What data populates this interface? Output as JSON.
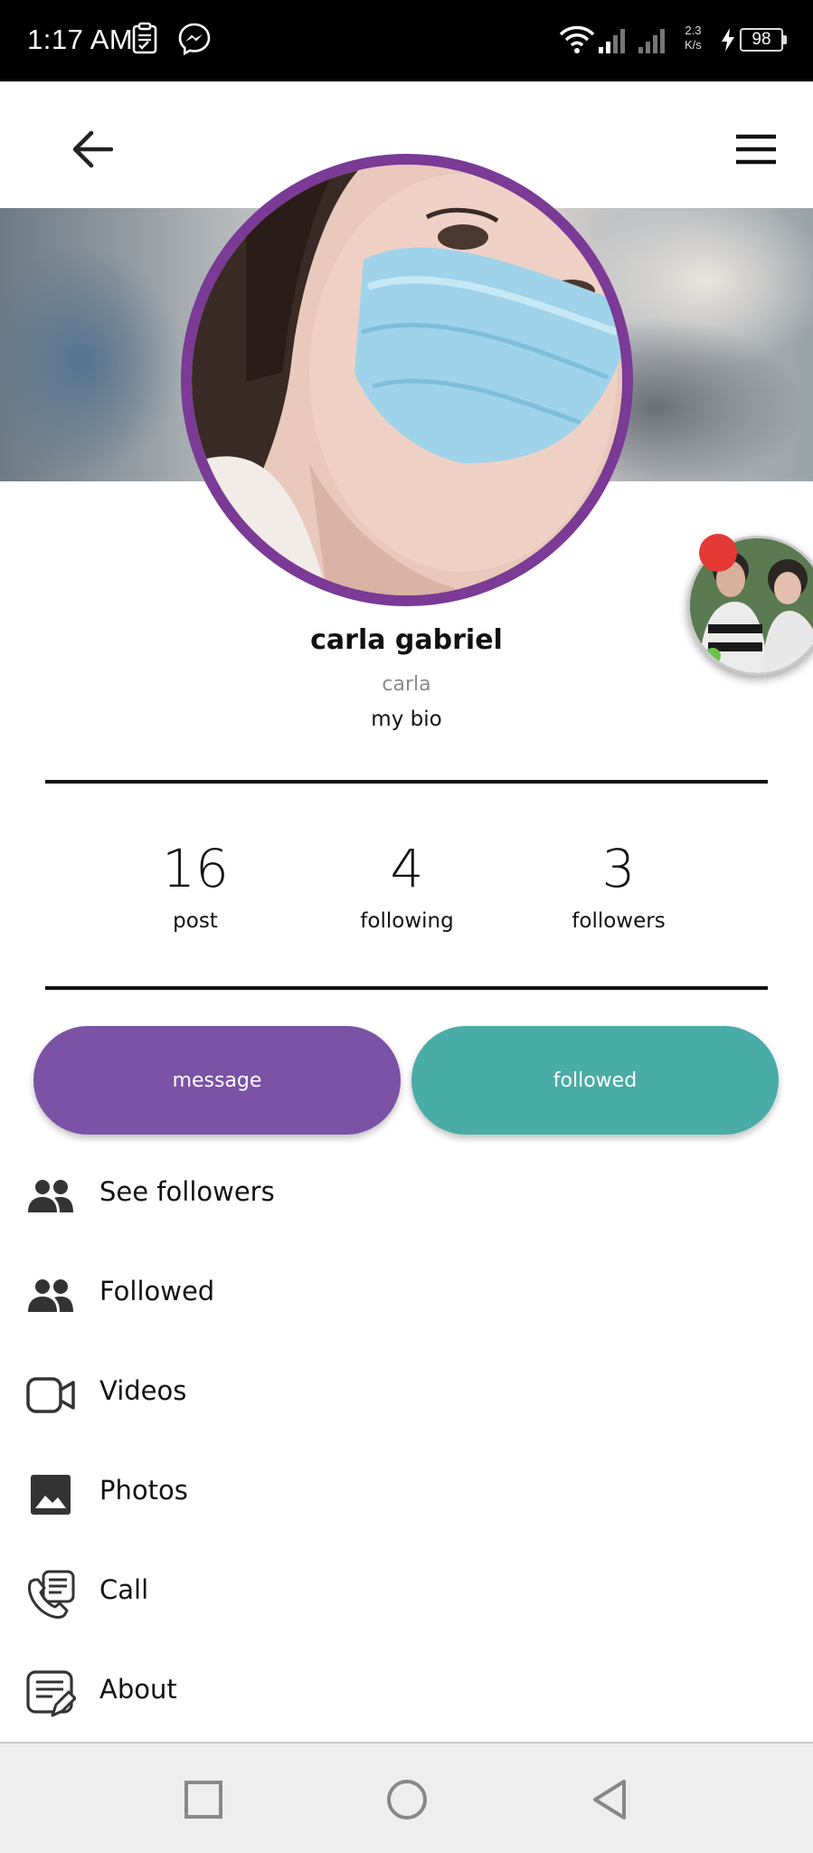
{
  "status_bar": {
    "time": "1:17 AM",
    "net_speed_value": "2.3",
    "net_speed_unit": "K/s",
    "battery": "98",
    "icons": [
      "clipboard-icon",
      "messenger-icon",
      "wifi-icon",
      "signal-icon",
      "charging-icon",
      "battery-icon"
    ]
  },
  "app_bar": {
    "back_icon": "arrow-left-icon",
    "menu_icon": "hamburger-menu-icon"
  },
  "profile": {
    "name": "carla gabriel",
    "username": "carla",
    "bio": "my bio",
    "avatar_ring_color": "#7a3a96"
  },
  "stats": [
    {
      "value": "16",
      "label": "post"
    },
    {
      "value": "4",
      "label": "following"
    },
    {
      "value": "3",
      "label": "followers"
    }
  ],
  "actions": {
    "message_label": "message",
    "message_color": "#7b52a6",
    "followed_label": "followed",
    "followed_color": "#4aaca7"
  },
  "menu": [
    {
      "label": "See followers",
      "icon": "people-icon"
    },
    {
      "label": "Followed",
      "icon": "people-icon"
    },
    {
      "label": "Videos",
      "icon": "video-camera-icon"
    },
    {
      "label": "Photos",
      "icon": "image-icon"
    },
    {
      "label": "Call",
      "icon": "phone-call-icon"
    },
    {
      "label": "About",
      "icon": "document-edit-icon"
    }
  ],
  "nav_bar": {
    "icons": [
      "recents-square-icon",
      "home-circle-icon",
      "back-triangle-icon"
    ]
  }
}
